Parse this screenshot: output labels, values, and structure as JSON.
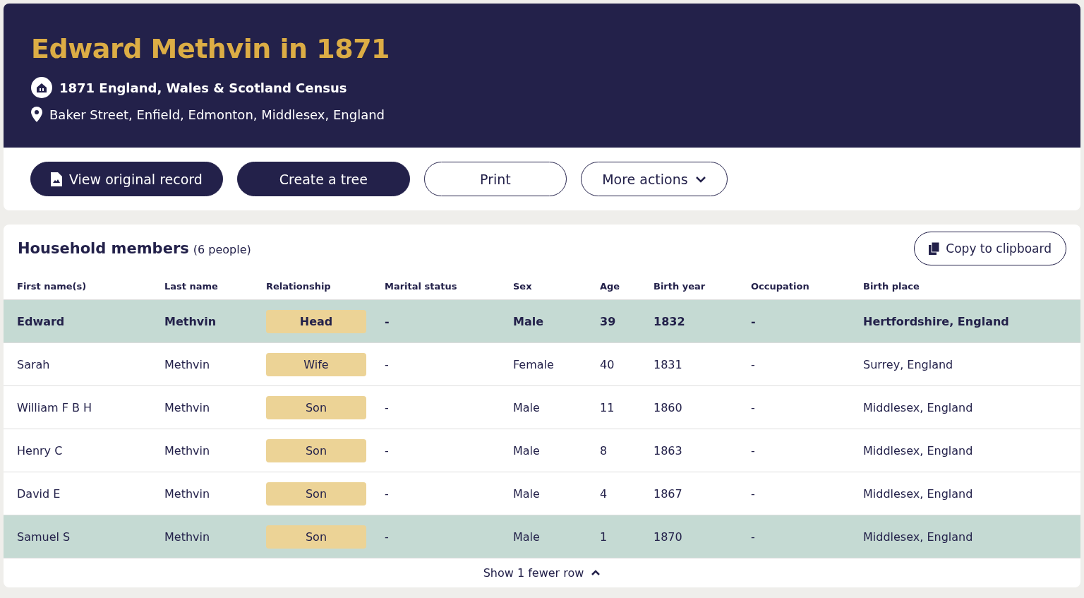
{
  "header": {
    "title": "Edward Methvin in 1871",
    "collection": "1871 England, Wales & Scotland Census",
    "address": "Baker Street, Enfield, Edmonton, Middlesex, England"
  },
  "actions": [
    {
      "label": "View original record",
      "kind": "primary-icon"
    },
    {
      "label": "Create a tree",
      "kind": "primary"
    },
    {
      "label": "Print",
      "kind": "outline"
    },
    {
      "label": "More actions",
      "kind": "dropdown"
    }
  ],
  "household": {
    "title": "Household members",
    "count": "(6 people)",
    "copy_button": "Copy to clipboard",
    "columns": [
      "First name(s)",
      "Last name",
      "Relationship",
      "Marital status",
      "Sex",
      "Age",
      "Birth year",
      "Occupation",
      "Birth place"
    ],
    "rows": [
      {
        "subject": true,
        "highlighted": true,
        "cells": [
          "Edward",
          "Methvin",
          "Head",
          "-",
          "Male",
          "39",
          "1832",
          "-",
          "Hertfordshire, England"
        ]
      },
      {
        "subject": false,
        "highlighted": false,
        "cells": [
          "Sarah",
          "Methvin",
          "Wife",
          "-",
          "Female",
          "40",
          "1831",
          "-",
          "Surrey, England"
        ]
      },
      {
        "subject": false,
        "highlighted": false,
        "cells": [
          "William F B H",
          "Methvin",
          "Son",
          "-",
          "Male",
          "11",
          "1860",
          "-",
          "Middlesex, England"
        ]
      },
      {
        "subject": false,
        "highlighted": false,
        "cells": [
          "Henry C",
          "Methvin",
          "Son",
          "-",
          "Male",
          "8",
          "1863",
          "-",
          "Middlesex, England"
        ]
      },
      {
        "subject": false,
        "highlighted": false,
        "cells": [
          "David E",
          "Methvin",
          "Son",
          "-",
          "Male",
          "4",
          "1867",
          "-",
          "Middlesex, England"
        ]
      },
      {
        "subject": false,
        "highlighted": true,
        "cells": [
          "Samuel S",
          "Methvin",
          "Son",
          "-",
          "Male",
          "1",
          "1870",
          "-",
          "Middlesex, England"
        ]
      }
    ],
    "toggle": "Show 1 fewer row"
  }
}
